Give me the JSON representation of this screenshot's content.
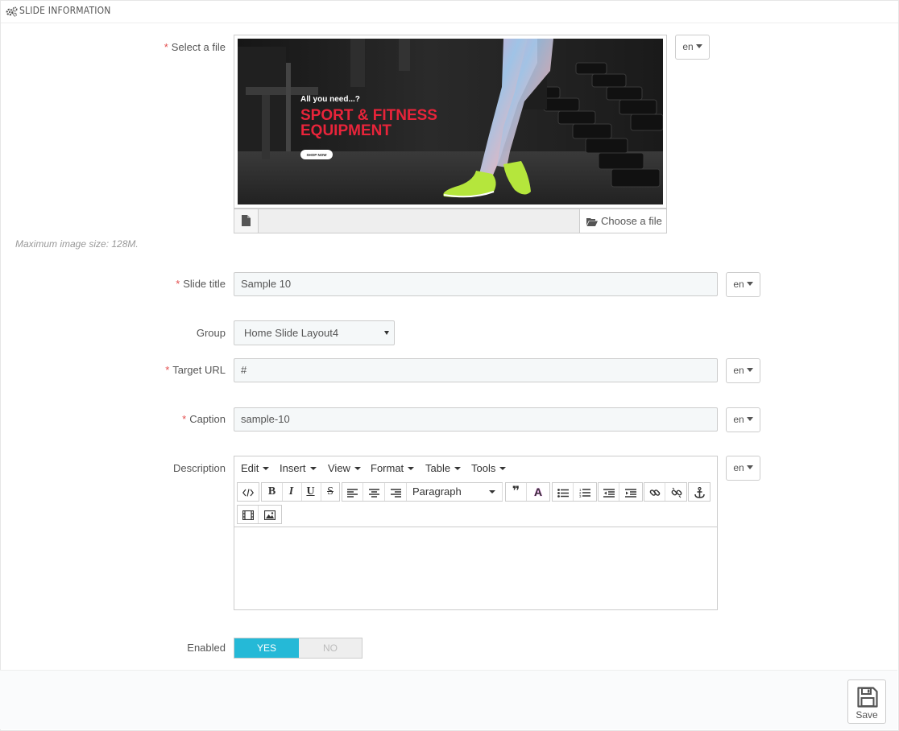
{
  "panel": {
    "title": "SLIDE INFORMATION"
  },
  "fields": {
    "select_file": {
      "label": "Select a file",
      "help": "Maximum image size: 128M.",
      "choose_label": "Choose a file"
    },
    "slide_title": {
      "label": "Slide title",
      "value": "Sample 10"
    },
    "group": {
      "label": "Group",
      "value": "Home Slide Layout4"
    },
    "target_url": {
      "label": "Target URL",
      "value": "#"
    },
    "caption": {
      "label": "Caption",
      "value": "sample-10"
    },
    "description": {
      "label": "Description"
    },
    "enabled": {
      "label": "Enabled",
      "yes": "YES",
      "no": "NO",
      "value": true
    }
  },
  "lang": "en",
  "required_mark": "*",
  "banner": {
    "line1": "All you need...?",
    "line2": "SPORT & FITNESS",
    "line3": "EQUIPMENT",
    "cta": "SHOP NOW"
  },
  "editor": {
    "menu": [
      "Edit",
      "Insert",
      "View",
      "Format",
      "Table",
      "Tools"
    ],
    "paragraph": "Paragraph",
    "bold": "B",
    "italic": "I",
    "underline": "U",
    "strike": "S",
    "quote": "❞",
    "textcolor": "A"
  },
  "footer": {
    "save_label": "Save"
  },
  "colors": {
    "accent": "#25b9d7",
    "required": "#e34d4d",
    "banner_red": "#e8243a",
    "shoe_green": "#b5e63c"
  }
}
